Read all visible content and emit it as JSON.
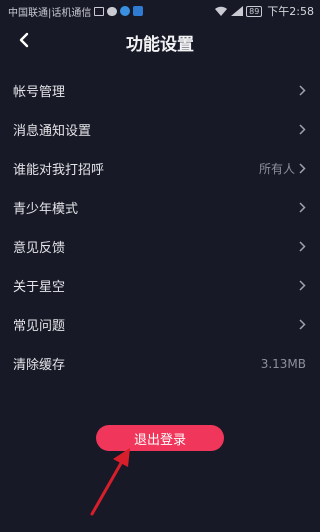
{
  "status_bar": {
    "carrier": "中国联通|话机通信",
    "battery": "89",
    "time": "下午2:58"
  },
  "nav": {
    "title": "功能设置"
  },
  "settings": [
    {
      "label": "帐号管理",
      "value": ""
    },
    {
      "label": "消息通知设置",
      "value": ""
    },
    {
      "label": "谁能对我打招呼",
      "value": "所有人"
    },
    {
      "label": "青少年模式",
      "value": ""
    },
    {
      "label": "意见反馈",
      "value": ""
    },
    {
      "label": "关于星空",
      "value": ""
    },
    {
      "label": "常见问题",
      "value": ""
    },
    {
      "label": "清除缓存",
      "value": "3.13MB"
    }
  ],
  "logout": {
    "label": "退出登录"
  },
  "colors": {
    "background": "#171a26",
    "accent": "#f0365a",
    "annotation_arrow": "#d81e2a"
  }
}
